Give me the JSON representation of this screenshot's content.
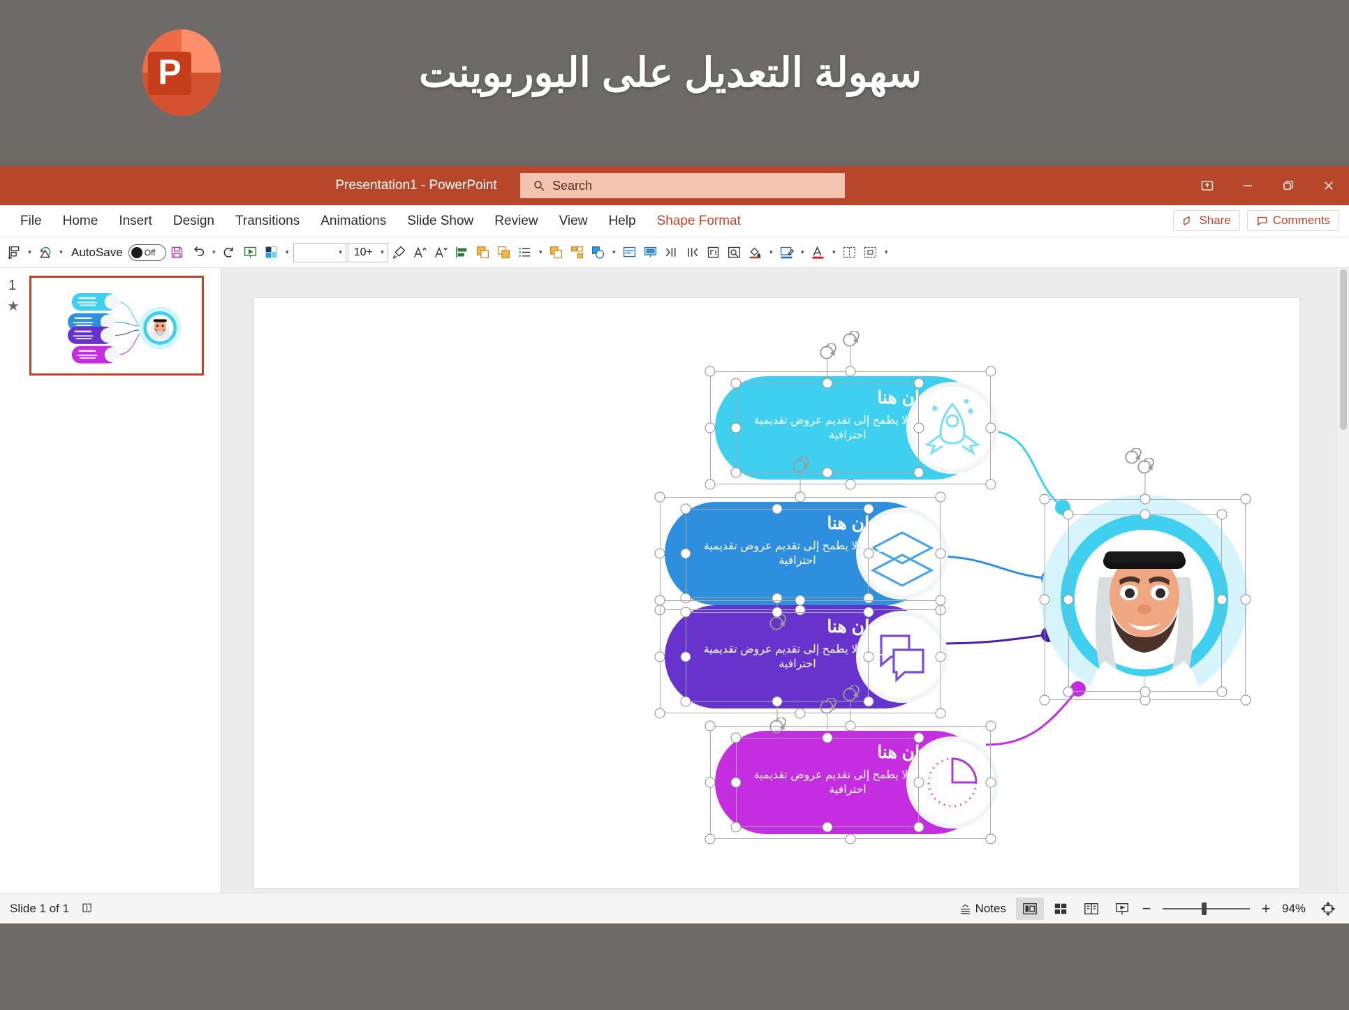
{
  "banner": {
    "title": "سهولة التعديل على البوربوينت",
    "logo_letter": "P",
    "logo_name": "powerpoint-logo",
    "bg": "#6e6a68"
  },
  "titlebar": {
    "document_title": "Presentation1  -  PowerPoint",
    "search_placeholder": "Search",
    "accent": "#b7472a",
    "window_buttons": [
      {
        "name": "ribbon-display-options",
        "label": "Ribbon Display Options"
      },
      {
        "name": "minimize-button",
        "label": "Minimize"
      },
      {
        "name": "restore-button",
        "label": "Restore Down"
      },
      {
        "name": "close-button",
        "label": "Close"
      }
    ]
  },
  "ribbon": {
    "tabs": [
      {
        "label": "File",
        "active": false,
        "contextual": false
      },
      {
        "label": "Home",
        "active": false,
        "contextual": false
      },
      {
        "label": "Insert",
        "active": false,
        "contextual": false
      },
      {
        "label": "Design",
        "active": false,
        "contextual": false
      },
      {
        "label": "Transitions",
        "active": false,
        "contextual": false
      },
      {
        "label": "Animations",
        "active": false,
        "contextual": false
      },
      {
        "label": "Slide Show",
        "active": false,
        "contextual": false
      },
      {
        "label": "Review",
        "active": false,
        "contextual": false
      },
      {
        "label": "View",
        "active": false,
        "contextual": false
      },
      {
        "label": "Help",
        "active": false,
        "contextual": false
      },
      {
        "label": "Shape Format",
        "active": true,
        "contextual": true
      }
    ],
    "share_label": "Share",
    "comments_label": "Comments"
  },
  "toolbar": {
    "autosave_label": "AutoSave",
    "autosave_state": "Off",
    "font_name": "",
    "font_size": "10+",
    "items": [
      "align-objects-icon",
      "rotate-objects-icon",
      "save-icon",
      "undo-icon",
      "redo-icon",
      "start-slideshow-icon",
      "shape-fill-icon",
      "format-painter-icon",
      "increase-font-size-icon",
      "decrease-font-size-icon",
      "align-left-icon",
      "bring-forward-icon",
      "send-backward-icon",
      "bullets-icon",
      "group-icon",
      "arrange-icon",
      "shapes-icon",
      "text-box-icon",
      "insert-placeholder-icon",
      "increase-indent-icon",
      "decrease-indent-icon",
      "text-direction-icon",
      "selection-pane-icon",
      "shape-fill-color-icon",
      "shape-outline-icon",
      "font-color-icon",
      "align-objects-grid-icon",
      "size-icon",
      "more-options-icon"
    ]
  },
  "thumbnails": {
    "slides": [
      {
        "number": "1",
        "animation_marker": "★",
        "selected": true
      }
    ]
  },
  "slide": {
    "cards": [
      {
        "id": "card-cyan",
        "title": "العنوان هنا",
        "body": "من منا لا يطمح إلى تقديم عروض تقديمية احترافية",
        "color": "#3fd0ef",
        "icon": "rocket-icon",
        "selected": true
      },
      {
        "id": "card-blue",
        "title": "العنوان هنا",
        "body": "من منا لا يطمح إلى تقديم عروض تقديمية احترافية",
        "color": "#2f8fdf",
        "icon": "layers-icon",
        "selected": true
      },
      {
        "id": "card-purple",
        "title": "العنوان هنا",
        "body": "من منا لا يطمح إلى تقديم عروض تقديمية احترافية",
        "color": "#6633cc",
        "icon": "chat-bubbles-icon",
        "selected": true
      },
      {
        "id": "card-magenta",
        "title": "العنوان هنا",
        "body": "من منا لا يطمح إلى تقديم عروض تقديمية احترافية",
        "color": "#c42ee0",
        "icon": "pie-chart-icon",
        "selected": true
      }
    ],
    "avatar": {
      "name": "arab-man-avatar",
      "ring_color": "#3fd0ef",
      "halo_color": "#d6f4fb",
      "selected": true
    },
    "connectors": [
      {
        "from": "card-cyan",
        "color": "#3fd0ef"
      },
      {
        "from": "card-blue",
        "color": "#2f8fdf"
      },
      {
        "from": "card-purple",
        "color": "#4b1fa8"
      },
      {
        "from": "card-magenta",
        "color": "#c42ee0"
      }
    ]
  },
  "status": {
    "slide_count": "Slide 1 of 1",
    "accessibility_icon": "accessibility-check-icon",
    "notes_label": "Notes",
    "zoom_percent": "94%",
    "zoom_minus": "−",
    "zoom_plus": "+",
    "views": [
      {
        "name": "normal-view-button",
        "active": true
      },
      {
        "name": "slide-sorter-button",
        "active": false
      },
      {
        "name": "reading-view-button",
        "active": false
      },
      {
        "name": "slideshow-button",
        "active": false
      }
    ],
    "fit-slide": "fit-slide-to-window-icon"
  }
}
